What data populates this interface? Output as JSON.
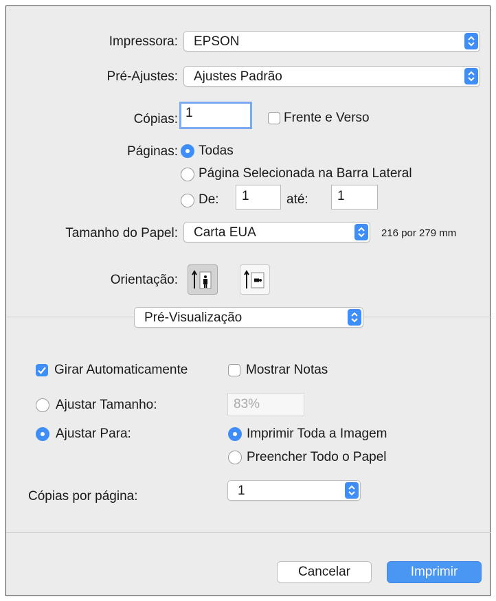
{
  "printer": {
    "label": "Impressora:",
    "value": "EPSON"
  },
  "presets": {
    "label": "Pré-Ajustes:",
    "value": "Ajustes Padrão"
  },
  "copies": {
    "label": "Cópias:",
    "value": "1",
    "duplex_label": "Frente e Verso",
    "duplex_checked": false
  },
  "pages": {
    "label": "Páginas:",
    "all_label": "Todas",
    "selected_label": "Página Selecionada na Barra Lateral",
    "from_label": "De:",
    "from_value": "1",
    "to_label": "até:",
    "to_value": "1",
    "selected_option": "all"
  },
  "paper_size": {
    "label": "Tamanho do Papel:",
    "value": "Carta EUA",
    "dimensions": "216 por 279 mm"
  },
  "orientation": {
    "label": "Orientação:",
    "selected": "portrait"
  },
  "section_popup": {
    "value": "Pré-Visualização"
  },
  "preview": {
    "auto_rotate_label": "Girar Automaticamente",
    "auto_rotate_checked": true,
    "show_notes_label": "Mostrar Notas",
    "show_notes_checked": false,
    "scale_label": "Ajustar Tamanho:",
    "scale_value": "83%",
    "fit_label": "Ajustar Para:",
    "fit_selected": true,
    "print_entire_label": "Imprimir Toda a Imagem",
    "fill_paper_label": "Preencher Todo o Papel",
    "fit_option": "print_entire",
    "copies_per_page_label": "Cópias por página:",
    "copies_per_page_value": "1"
  },
  "buttons": {
    "cancel": "Cancelar",
    "print": "Imprimir"
  },
  "colors": {
    "accent": "#3f8ef7",
    "primary_button": "#4a96f3",
    "dialog_bg": "#ececec"
  }
}
